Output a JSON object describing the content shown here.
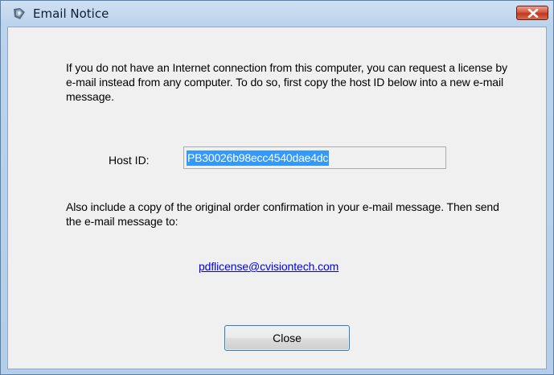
{
  "window": {
    "title": "Email Notice",
    "icon": "app-icon",
    "close_icon": "close-x-icon"
  },
  "intro_text": "If you do not have an Internet connection from this computer, you can request a license by e-mail instead from any computer.  To do so, first copy the host ID below into a new e-mail message.",
  "host": {
    "label": "Host ID:",
    "value": "PB30026b98ecc4540dae4dc"
  },
  "also_text": "Also include a copy of the original order confirmation in your e-mail message.  Then send the e-mail message to:",
  "email": "pdflicense@cvisiontech.com",
  "close_button_label": "Close",
  "colors": {
    "selection": "#3399ff",
    "link": "#0000ee",
    "close_red": "#c0371e"
  }
}
